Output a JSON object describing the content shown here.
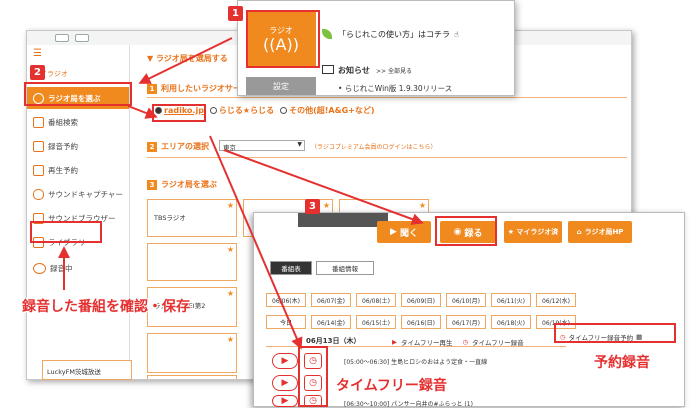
{
  "sidebar": {
    "items": [
      {
        "label": "マイラジオ"
      },
      {
        "label": "ラジオ局を選ぶ"
      },
      {
        "label": "番組検索"
      },
      {
        "label": "録音予約"
      },
      {
        "label": "再生予約"
      },
      {
        "label": "サウンドキャプチャー"
      },
      {
        "label": "サウンドブラウザー"
      },
      {
        "label": "ライブラリ"
      },
      {
        "label": "録音中"
      }
    ]
  },
  "content": {
    "heading": "▼ ラジオ局を選局する",
    "step1": {
      "num": "1",
      "label": "利用したいラジオサー"
    },
    "radio_options": [
      "radiko.jp",
      "らじる★らじる",
      "その他(超!A&G+など)"
    ],
    "step2": {
      "num": "2",
      "label": "エリアの選択",
      "area_value": "東京",
      "note": "（ラジコプレミアム会員のログインはこちら）"
    },
    "step3": {
      "num": "3",
      "label": "ラジオ局を選ぶ"
    },
    "stations": [
      "TBSラジオ",
      "ラジオNIKKEI第2",
      "LuckyFM茨城放送"
    ],
    "star": "★"
  },
  "popup_top": {
    "radio_label": "ラジオ",
    "settings_label": "設定",
    "howto": "「らじれこの使い方」はコチラ",
    "news_title": "お知らせ",
    "news_all": ">> 全部見る",
    "news_item": "らじれこWin版 1.9.30リリース"
  },
  "popup_low": {
    "listen": "聞く",
    "record": "録る",
    "myradio": "★ マイラジオ済",
    "station_hp": "ラジオ局HP",
    "tab_schedule": "番組表",
    "tab_info": "番組情報",
    "dates_row1": [
      "06/06(木)",
      "06/07(金)",
      "06/08(土)",
      "06/09(日)",
      "06/10(月)",
      "06/11(火)",
      "06/12(水)"
    ],
    "dates_row2": [
      "今日",
      "06/14(金)",
      "06/15(土)",
      "06/16(日)",
      "06/17(月)",
      "06/18(火)",
      "06/19(水)"
    ],
    "date_heading": "06月13日（木）",
    "timefree_play": "タイムフリー再生",
    "timefree_rec": "タイムフリー録音",
    "timefree_reserve": "タイムフリー録音予約",
    "prog1": "[05:00〜06:30] 生島ヒロシのおはよう定食・一直線",
    "prog2": "[06:30〜10:00] パンサー向井の#ふらっと (1)"
  },
  "callouts": {
    "badge1": "1",
    "badge2": "2",
    "badge3": "3",
    "label_library": "録音した番組を確認・保存",
    "label_timefree": "タイムフリー録音",
    "label_reserve": "予約録音"
  },
  "colors": {
    "accent": "#f08a1f",
    "callout": "#e53030"
  }
}
